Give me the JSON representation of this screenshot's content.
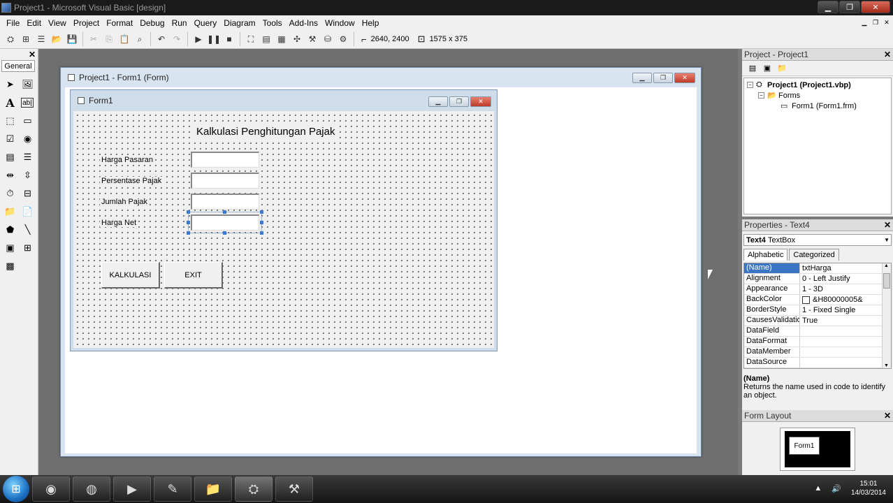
{
  "window": {
    "title": "Project1 - Microsoft Visual Basic [design]"
  },
  "menu": {
    "items": [
      "File",
      "Edit",
      "View",
      "Project",
      "Format",
      "Debug",
      "Run",
      "Query",
      "Diagram",
      "Tools",
      "Add-Ins",
      "Window",
      "Help"
    ]
  },
  "toolbar": {
    "position_readout": "2640, 2400",
    "size_readout": "1575 x 375"
  },
  "toolbox": {
    "tab_label": "General"
  },
  "designer": {
    "title": "Project1 - Form1 (Form)"
  },
  "form1": {
    "title": "Form1",
    "heading": "Kalkulasi Penghitungan Pajak",
    "labels": [
      "Harga Pasaran",
      "Persentase Pajak",
      "Jumlah Pajak",
      "Harga Net"
    ],
    "buttons": {
      "kalkulasi": "KALKULASI",
      "exit": "EXIT"
    }
  },
  "project_panel": {
    "title": "Project - Project1",
    "tree": {
      "project": "Project1 (Project1.vbp)",
      "forms_folder": "Forms",
      "form_item": "Form1 (Form1.frm)"
    }
  },
  "properties_panel": {
    "title": "Properties - Text4",
    "object_name": "Text4",
    "object_type": "TextBox",
    "tabs": [
      "Alphabetic",
      "Categorized"
    ],
    "rows": [
      {
        "name": "(Name)",
        "value": "txtHarga"
      },
      {
        "name": "Alignment",
        "value": "0 - Left Justify"
      },
      {
        "name": "Appearance",
        "value": "1 - 3D"
      },
      {
        "name": "BackColor",
        "value": "&H80000005&"
      },
      {
        "name": "BorderStyle",
        "value": "1 - Fixed Single"
      },
      {
        "name": "CausesValidation",
        "value": "True"
      },
      {
        "name": "DataField",
        "value": ""
      },
      {
        "name": "DataFormat",
        "value": ""
      },
      {
        "name": "DataMember",
        "value": ""
      },
      {
        "name": "DataSource",
        "value": ""
      }
    ],
    "description_title": "(Name)",
    "description_text": "Returns the name used in code to identify an object."
  },
  "form_layout_panel": {
    "title": "Form Layout",
    "mini_form_label": "Form1"
  },
  "taskbar": {
    "time": "15:01",
    "date": "14/03/2014"
  },
  "icons": {
    "taskbar_apps": [
      "firefox-icon",
      "network-globe-icon",
      "media-player-icon",
      "notepad-icon",
      "file-explorer-icon",
      "visual-basic-icon",
      "tool-icon"
    ]
  }
}
